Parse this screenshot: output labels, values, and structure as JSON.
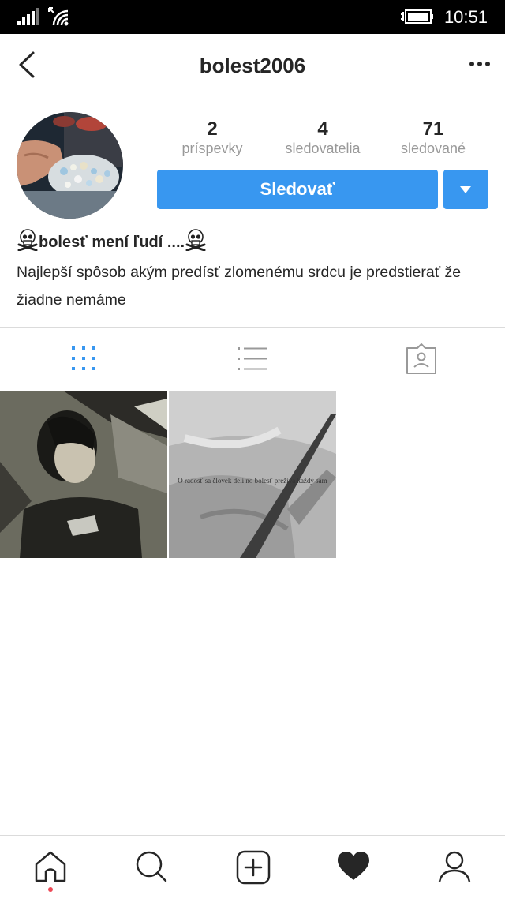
{
  "status_bar": {
    "time": "10:51"
  },
  "header": {
    "username": "bolest2006"
  },
  "stats": [
    {
      "count": "2",
      "label": "príspevky"
    },
    {
      "count": "4",
      "label": "sledovatelia"
    },
    {
      "count": "71",
      "label": "sledované"
    }
  ],
  "actions": {
    "follow_label": "Sledovať"
  },
  "bio": {
    "name": "bolesť mení ľudí ....",
    "text": "Najlepší spôsob akým predísť zlomenému srdcu je predstierať že žiadne nemáme"
  },
  "posts": [
    {
      "caption": ""
    },
    {
      "caption": "O radosť sa človek delí no bolesť prežíva každý sám"
    }
  ],
  "icons": {
    "back": "chevron-left-icon",
    "more": "more-horizontal-icon",
    "tab_grid": "grid-icon",
    "tab_list": "list-icon",
    "tab_tagged": "tagged-icon",
    "nav": [
      "home-icon",
      "search-icon",
      "add-icon",
      "heart-icon",
      "profile-icon"
    ]
  },
  "colors": {
    "accent": "#3897f0",
    "notification": "#ed4956"
  }
}
